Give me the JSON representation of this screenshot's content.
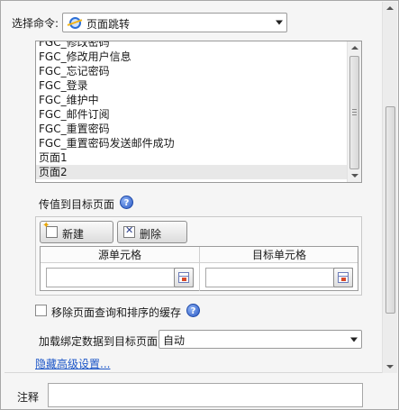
{
  "command": {
    "label": "选择命令:",
    "selected": "页面跳转",
    "icon": "ie-icon"
  },
  "page_list": {
    "items": [
      "FGC_修改密码",
      "FGC_修改用户信息",
      "FGC_忘记密码",
      "FGC_登录",
      "FGC_维护中",
      "FGC_邮件订阅",
      "FGC_重置密码",
      "FGC_重置密码发送邮件成功",
      "页面1",
      "页面2"
    ],
    "selected_item": "页面2"
  },
  "pass_values": {
    "label": "传值到目标页面",
    "new_button": "新建",
    "delete_button": "删除",
    "columns": [
      "源单元格",
      "目标单元格"
    ]
  },
  "remove_cache": {
    "label": "移除页面查询和排序的缓存",
    "checked": false
  },
  "load_binding": {
    "label": "加载绑定数据到目标页面",
    "selected": "自动"
  },
  "advanced_link": "隐藏高级设置...",
  "notes": {
    "label": "注释",
    "value": ""
  },
  "colors": {
    "link": "#1b55c7",
    "help_icon": "#2a59c4",
    "selection": "#e8e8e8"
  }
}
